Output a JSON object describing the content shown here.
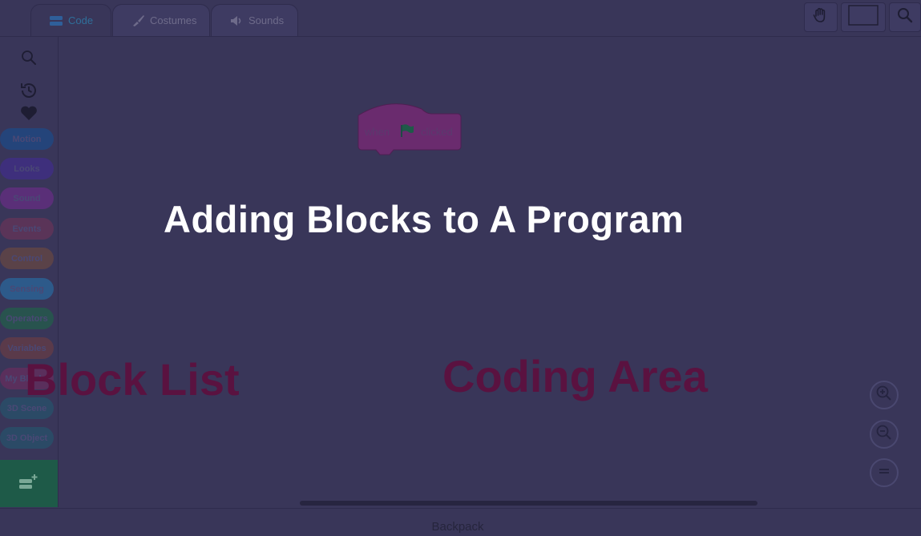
{
  "tabs": [
    {
      "label": "Code",
      "icon": "code-icon",
      "active": true
    },
    {
      "label": "Costumes",
      "icon": "brush-icon",
      "active": false
    },
    {
      "label": "Sounds",
      "icon": "speaker-icon",
      "active": false
    }
  ],
  "toolbar": {
    "icons": [
      "hand-icon",
      "stage-size-icon",
      "search-icon"
    ]
  },
  "sidebar": {
    "icons": [
      "search-icon",
      "history-icon",
      "heart-icon"
    ],
    "categories": [
      {
        "label": "Motion",
        "color": "#24447a"
      },
      {
        "label": "Looks",
        "color": "#3e2f7c"
      },
      {
        "label": "Sound",
        "color": "#5a2f78"
      },
      {
        "label": "Events",
        "color": "#5a3458"
      },
      {
        "label": "Control",
        "color": "#5a4248"
      },
      {
        "label": "Sensing",
        "color": "#2d5a8a"
      },
      {
        "label": "Operators",
        "color": "#28534e"
      },
      {
        "label": "Variables",
        "color": "#5a3a4a"
      },
      {
        "label": "My Blocks",
        "color": "#5a2f5c"
      },
      {
        "label": "3D Scene",
        "color": "#2b4a66"
      },
      {
        "label": "3D Object",
        "color": "#2b4a66"
      }
    ],
    "extension_icon": "add-extension-icon"
  },
  "script": {
    "hat_block": {
      "word1": "when",
      "word2": "clicked",
      "icon": "green-flag-icon",
      "color": "#6a2b6e"
    }
  },
  "overlay": {
    "title": "Adding Blocks to A Program",
    "block_list_label": "Block List",
    "coding_area_label": "Coding Area"
  },
  "zoom": {
    "icons": [
      "zoom-in-icon",
      "zoom-out-icon",
      "zoom-reset-icon"
    ]
  },
  "backpack": {
    "label": "Backpack"
  }
}
